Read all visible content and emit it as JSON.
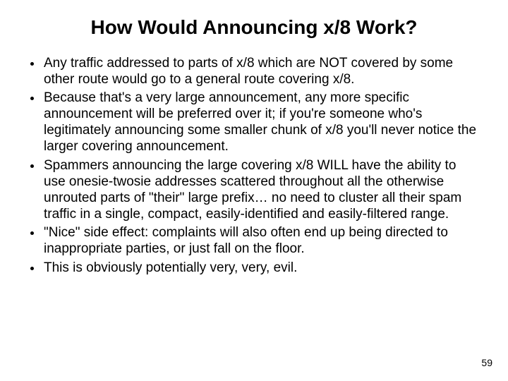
{
  "title": "How Would Announcing x/8 Work?",
  "bullets": [
    "Any traffic addressed to parts of x/8 which are NOT covered by some other route would go to a general route covering x/8.",
    "Because that's a very large announcement, any more specific announcement will be preferred over it; if you're someone who's legitimately announcing some smaller chunk of x/8 you'll never notice the larger covering announcement.",
    "Spammers announcing the large covering x/8 WILL have the ability to use onesie-twosie addresses scattered throughout all the otherwise unrouted parts of \"their\" large prefix… no need to cluster all their spam traffic in a single, compact, easily-identified and easily-filtered range.",
    "\"Nice\" side effect: complaints will also often end up being directed to inappropriate parties, or just fall on the floor.",
    "This is obviously potentially very, very, evil."
  ],
  "page_number": "59"
}
